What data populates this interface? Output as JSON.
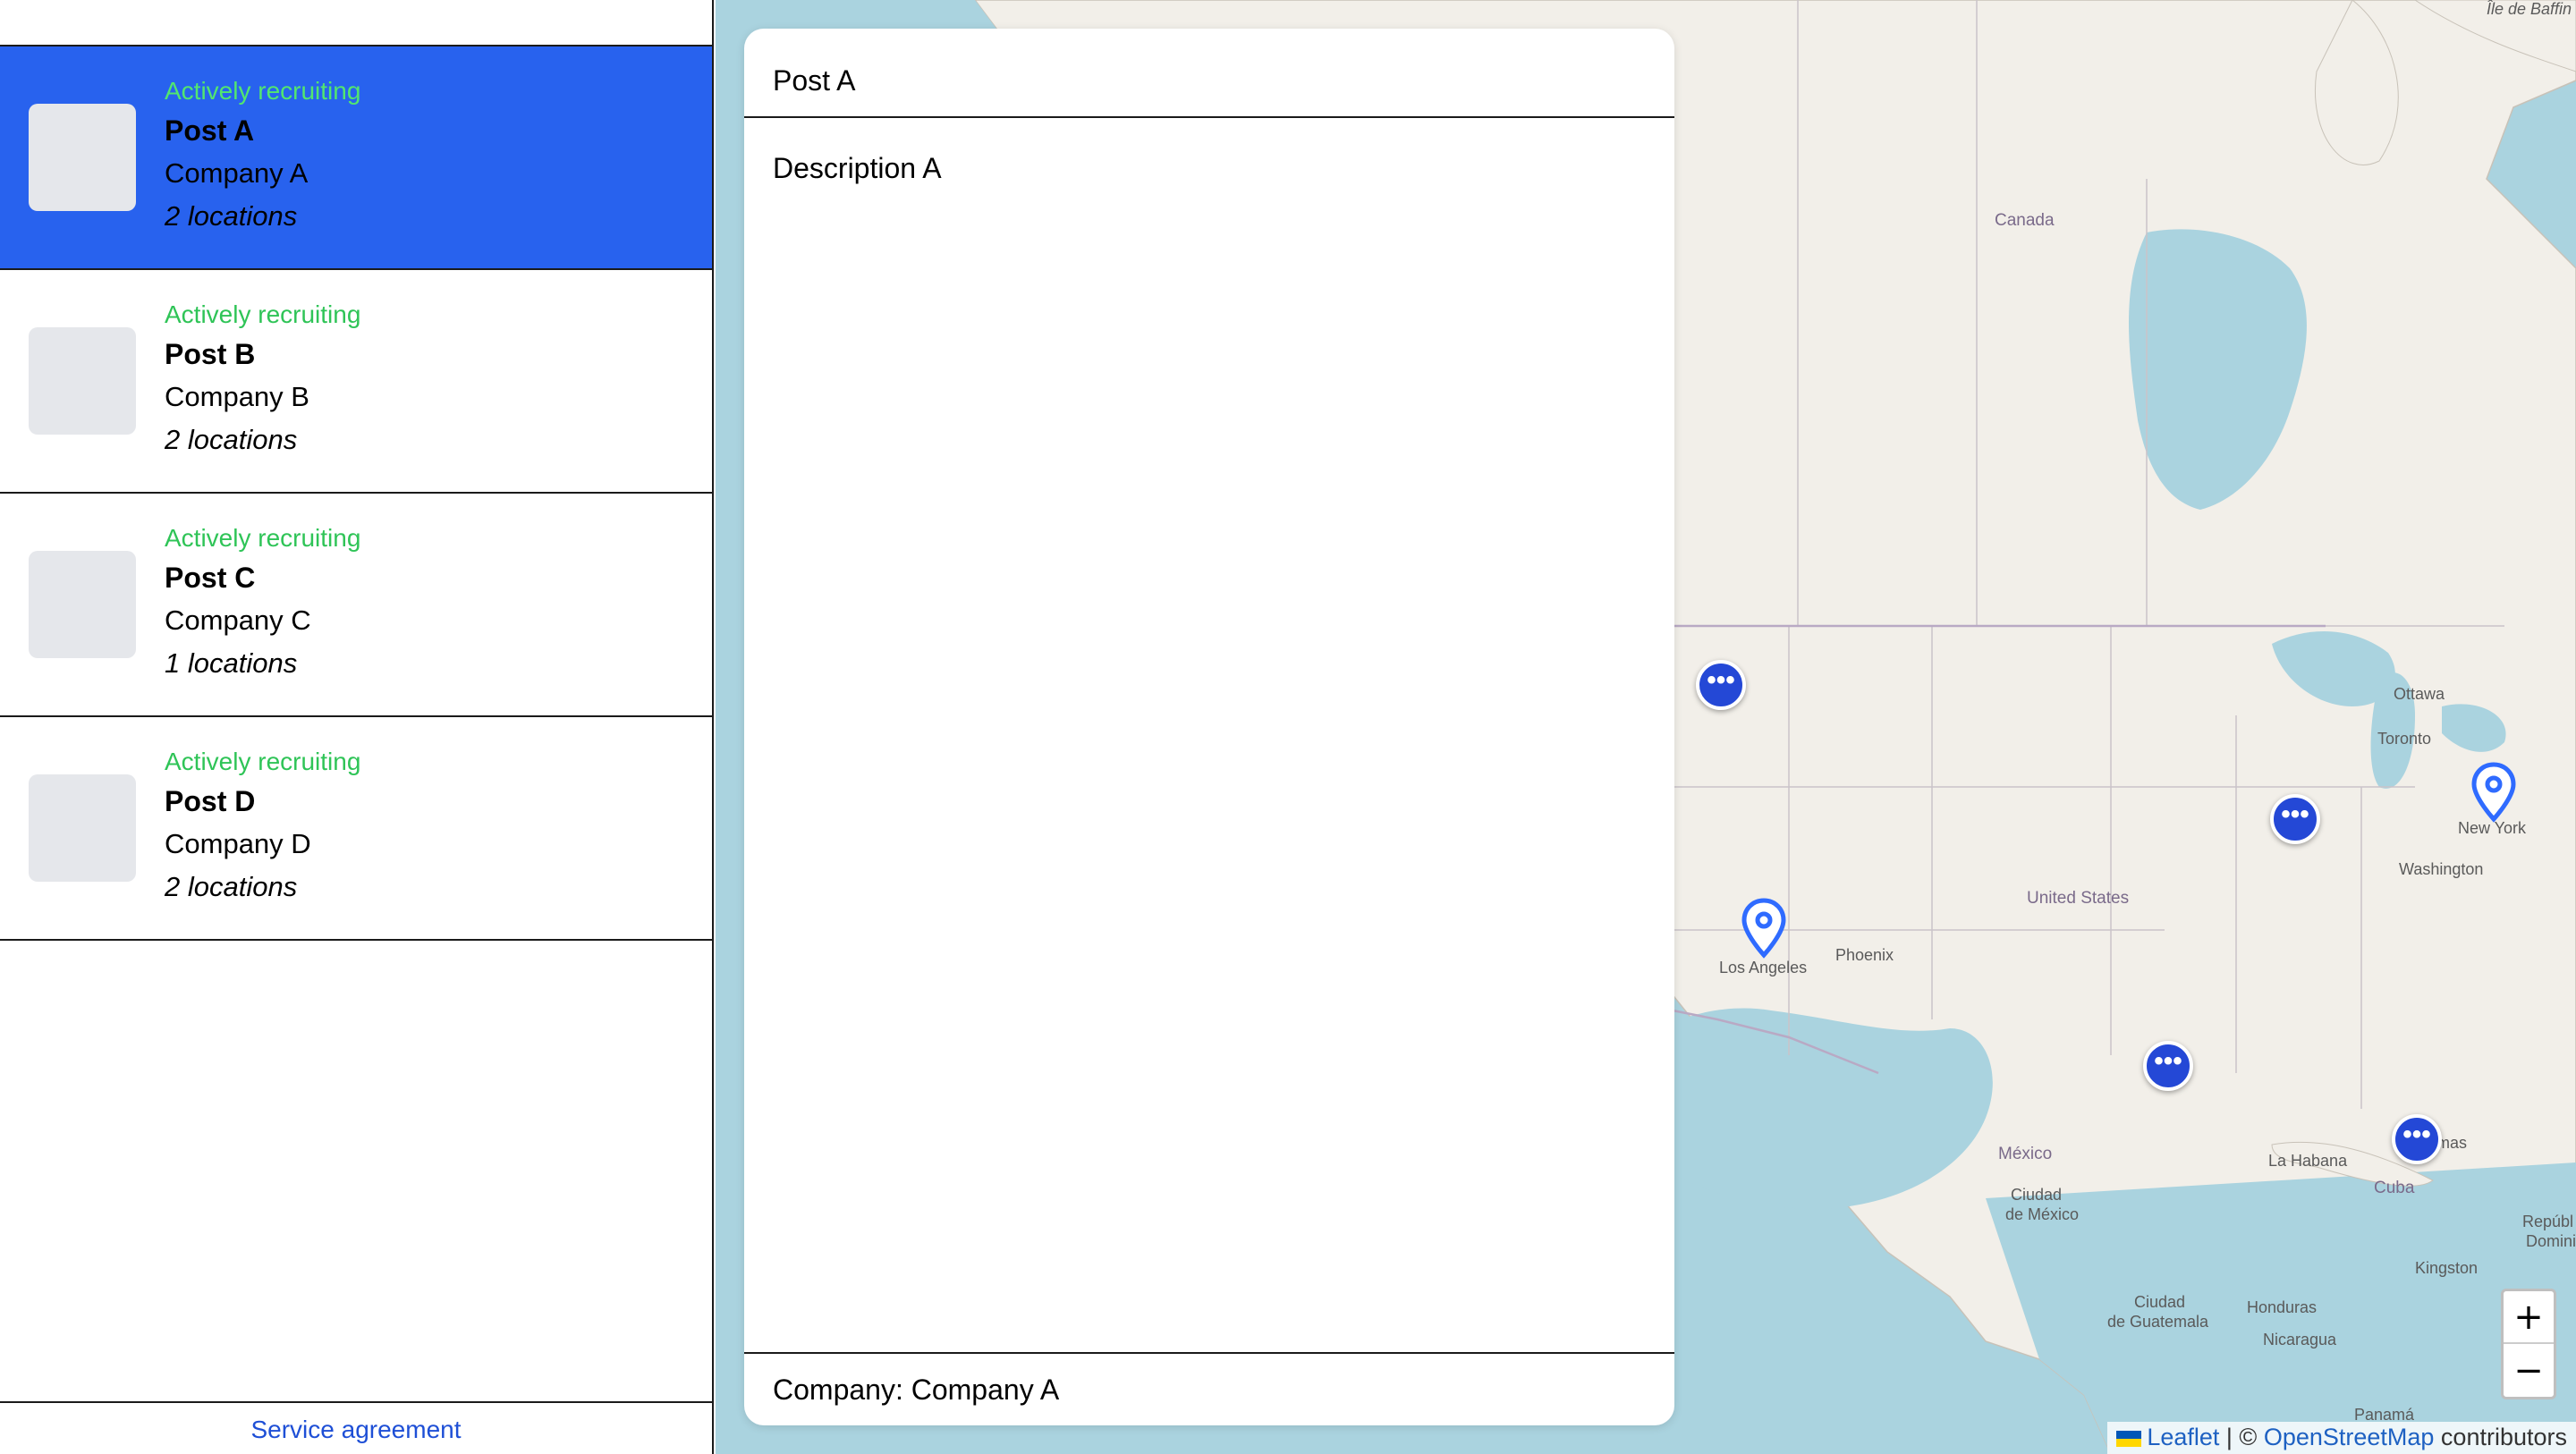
{
  "sidebar": {
    "posts": [
      {
        "status": "Actively recruiting",
        "title": "Post A",
        "company": "Company A",
        "locations": "2 locations",
        "selected": true
      },
      {
        "status": "Actively recruiting",
        "title": "Post B",
        "company": "Company B",
        "locations": "2 locations",
        "selected": false
      },
      {
        "status": "Actively recruiting",
        "title": "Post C",
        "company": "Company C",
        "locations": "1 locations",
        "selected": false
      },
      {
        "status": "Actively recruiting",
        "title": "Post D",
        "company": "Company D",
        "locations": "2 locations",
        "selected": false
      }
    ],
    "footer_link": "Service agreement"
  },
  "detail": {
    "title": "Post A",
    "description": "Description A",
    "company_line": "Company: Company A"
  },
  "map": {
    "labels": {
      "ile_de_baffin": "Île de Baffin",
      "canada": "Canada",
      "united_states": "United States",
      "mexico": "México",
      "cuba": "Cuba",
      "ottawa": "Ottawa",
      "toronto": "Toronto",
      "new_york": "New York",
      "washington": "Washington",
      "los_angeles": "Los Angeles",
      "phoenix": "Phoenix",
      "la_habana": "La Habana",
      "bahamas": "amas",
      "ciudad_de_mexico_1": "Ciudad",
      "ciudad_de_mexico_2": "de México",
      "kingston": "Kingston",
      "honduras": "Honduras",
      "nicaragua": "Nicaragua",
      "guatemala_1": "Ciudad",
      "guatemala_2": "de Guatemala",
      "republica_1": "Repúbl",
      "republica_2": "Domini",
      "panama": "Panamá"
    },
    "cluster_marker_label": "•••",
    "markers": [
      "cluster-marker",
      "cluster-marker",
      "cluster-marker",
      "cluster-marker",
      "location-pin-icon",
      "location-pin-icon"
    ],
    "zoom": {
      "in": "+",
      "out": "−"
    },
    "attribution": {
      "leaflet": "Leaflet",
      "separator": " | © ",
      "osm": "OpenStreetMap",
      "suffix": " contributors"
    }
  },
  "colors": {
    "selected_bg": "#2862ee",
    "status_green": "#2fc457",
    "marker_blue": "#2448d6",
    "water": "#aad3df",
    "land": "#f2efe9"
  }
}
